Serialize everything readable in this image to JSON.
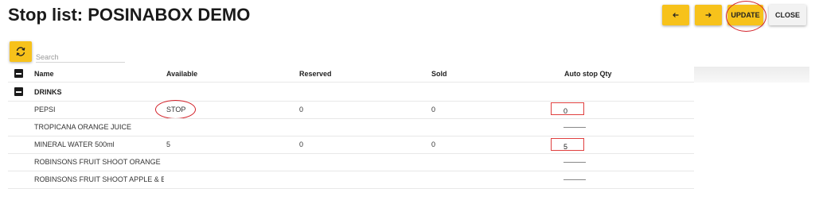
{
  "page": {
    "title": "Stop list: POSINABOX DEMO"
  },
  "toolbar": {
    "prev_icon": "arrow-left-icon",
    "next_icon": "arrow-right-icon",
    "update_label": "UPDATE",
    "close_label": "CLOSE",
    "accent_color": "#f7c21b",
    "annotation_color": "#d3222a"
  },
  "search": {
    "placeholder": "Search",
    "value": "",
    "refresh_icon": "refresh-icon"
  },
  "table": {
    "headers": {
      "name": "Name",
      "available": "Available",
      "reserved": "Reserved",
      "sold": "Sold",
      "auto_stop_qty": "Auto stop Qty"
    },
    "category": "DRINKS",
    "rows": [
      {
        "name": "PEPSI",
        "available": "STOP",
        "reserved": "0",
        "sold": "0",
        "auto_stop_qty": "0"
      },
      {
        "name": "TROPICANA ORANGE JUICE",
        "available": "",
        "reserved": "",
        "sold": "",
        "auto_stop_qty": ""
      },
      {
        "name": "MINERAL WATER 500ml",
        "available": "5",
        "reserved": "0",
        "sold": "0",
        "auto_stop_qty": "5"
      },
      {
        "name": "ROBINSONS FRUIT SHOOT ORANGE",
        "available": "",
        "reserved": "",
        "sold": "",
        "auto_stop_qty": ""
      },
      {
        "name": "ROBINSONS FRUIT SHOOT APPLE & BLACKCURRANT",
        "available": "",
        "reserved": "",
        "sold": "",
        "auto_stop_qty": ""
      }
    ]
  }
}
